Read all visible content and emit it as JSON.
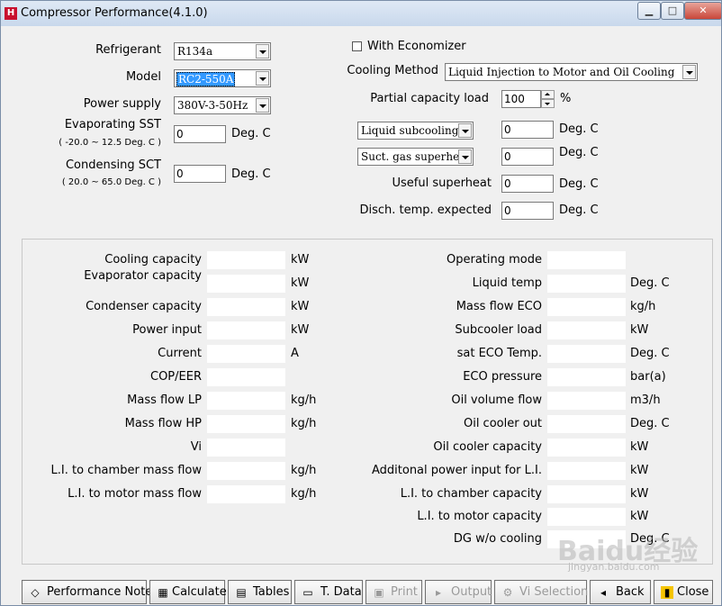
{
  "window": {
    "title": "Compressor Performance(4.1.0)",
    "app_icon_glyph": "H",
    "controls": {
      "minimize": "▁",
      "maximize": "□",
      "close": "✕"
    }
  },
  "inputs": {
    "refrigerant": {
      "label": "Refrigerant",
      "value": "R134a"
    },
    "model": {
      "label": "Model",
      "value": "RC2-550A"
    },
    "power_supply": {
      "label": "Power supply",
      "value": "380V-3-50Hz"
    },
    "evap_sst": {
      "label": "Evaporating SST",
      "range": "( -20.0 ~ 12.5 Deg. C )",
      "value": "0",
      "unit": "Deg. C"
    },
    "cond_sct": {
      "label": "Condensing SCT",
      "range": "( 20.0 ~ 65.0 Deg. C )",
      "value": "0",
      "unit": "Deg. C"
    },
    "economizer": {
      "label": "With Economizer",
      "checked": false
    },
    "cooling_method": {
      "label": "Cooling Method",
      "value": "Liquid Injection to Motor and Oil Cooling"
    },
    "partial_load": {
      "label": "Partial capacity load",
      "value": "100",
      "unit": "%"
    },
    "liquid_subcooling": {
      "option": "Liquid subcooling",
      "value": "0",
      "unit": "Deg. C"
    },
    "suct_superheat": {
      "option": "Suct. gas superheat",
      "value": "0",
      "unit": "Deg. C"
    },
    "useful_superheat": {
      "label": "Useful superheat",
      "value": "0",
      "unit": "Deg. C"
    },
    "disch_temp": {
      "label": "Disch. temp. expected",
      "value": "0",
      "unit": "Deg. C"
    }
  },
  "results_left": [
    {
      "label": "Cooling capacity",
      "unit": "kW"
    },
    {
      "label": "Evaporator capacity",
      "unit": "kW"
    },
    {
      "label": "Condenser capacity",
      "unit": "kW"
    },
    {
      "label": "Power input",
      "unit": "kW"
    },
    {
      "label": "Current",
      "unit": "A"
    },
    {
      "label": "COP/EER",
      "unit": ""
    },
    {
      "label": "Mass flow LP",
      "unit": "kg/h"
    },
    {
      "label": "Mass flow HP",
      "unit": "kg/h"
    },
    {
      "label": "Vi",
      "unit": ""
    },
    {
      "label": "L.I. to chamber mass flow",
      "unit": "kg/h"
    },
    {
      "label": "L.I. to motor mass flow",
      "unit": "kg/h"
    }
  ],
  "results_right": [
    {
      "label": "Operating mode",
      "unit": ""
    },
    {
      "label": "Liquid temp",
      "unit": "Deg. C"
    },
    {
      "label": "Mass flow ECO",
      "unit": "kg/h"
    },
    {
      "label": "Subcooler load",
      "unit": "kW"
    },
    {
      "label": "sat ECO Temp.",
      "unit": "Deg. C"
    },
    {
      "label": "ECO pressure",
      "unit": "bar(a)"
    },
    {
      "label": "Oil volume flow",
      "unit": "m3/h"
    },
    {
      "label": "Oil cooler out",
      "unit": "Deg. C"
    },
    {
      "label": "Oil cooler capacity",
      "unit": "kW"
    },
    {
      "label": "Additonal power input for L.I.",
      "unit": "kW"
    },
    {
      "label": "L.I. to chamber capacity",
      "unit": "kW"
    },
    {
      "label": "L.I. to motor capacity",
      "unit": "kW"
    },
    {
      "label": "DG w/o cooling",
      "unit": "Deg. C"
    }
  ],
  "buttons": [
    {
      "label": "Performance Note",
      "icon": "note-icon",
      "enabled": true
    },
    {
      "label": "Calculate",
      "icon": "calculator-icon",
      "enabled": true
    },
    {
      "label": "Tables",
      "icon": "table-icon",
      "enabled": true
    },
    {
      "label": "T. Data",
      "icon": "document-icon",
      "enabled": true
    },
    {
      "label": "Print",
      "icon": "printer-icon",
      "enabled": false
    },
    {
      "label": "Output",
      "icon": "export-icon",
      "enabled": false
    },
    {
      "label": "Vi Selection",
      "icon": "gear-icon",
      "enabled": false
    },
    {
      "label": "Back",
      "icon": "back-icon",
      "enabled": true
    },
    {
      "label": "Close",
      "icon": "door-icon",
      "enabled": true
    }
  ],
  "watermark": {
    "text": "Baidu经验",
    "sub": "jingyan.baidu.com"
  },
  "colors": {
    "selection": "#3399ff",
    "titlebar": "#c8d8ec",
    "close_button": "#c9473a"
  }
}
